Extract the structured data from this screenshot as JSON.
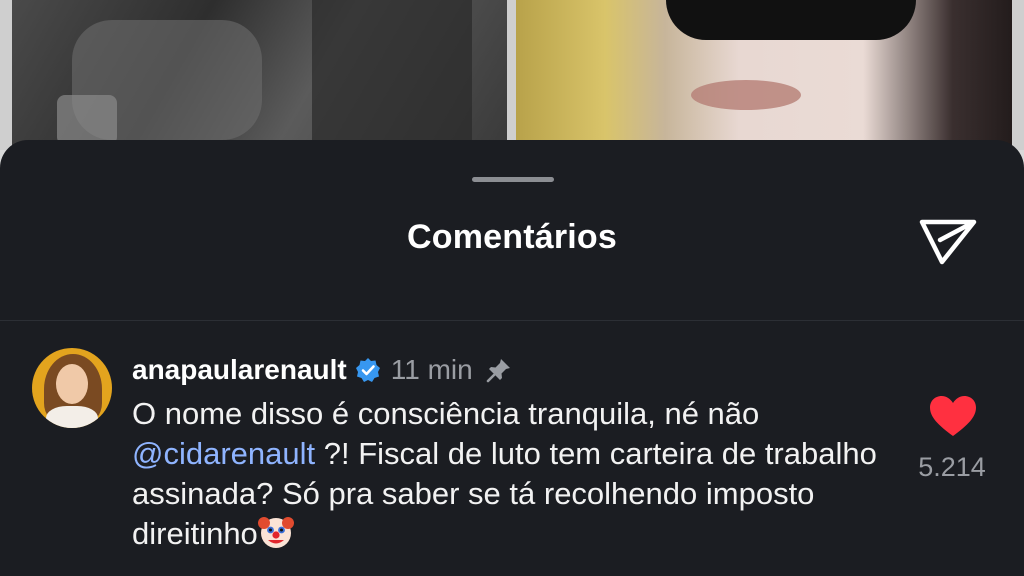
{
  "sheet": {
    "title": "Comentários"
  },
  "comment": {
    "username": "anapaularenault",
    "time": "11 min",
    "text_before_mention": "O nome disso é consciência tranquila, né não ",
    "mention": "@cidarenault",
    "text_after_mention": " ?! Fiscal de luto tem carteira de trabalho assinada? Só pra saber se tá recolhendo imposto direitinho",
    "like_count": "5.214",
    "liked": true
  },
  "colors": {
    "sheet_bg": "#1b1d22",
    "accent_mention": "#8fb4ff",
    "verified_badge": "#3797f0",
    "like_red": "#ff3040"
  },
  "icons": {
    "share": "paper-plane-icon",
    "verified": "verified-badge-icon",
    "pin": "pin-icon",
    "like": "heart-icon",
    "emoji": "clown-face-emoji"
  }
}
